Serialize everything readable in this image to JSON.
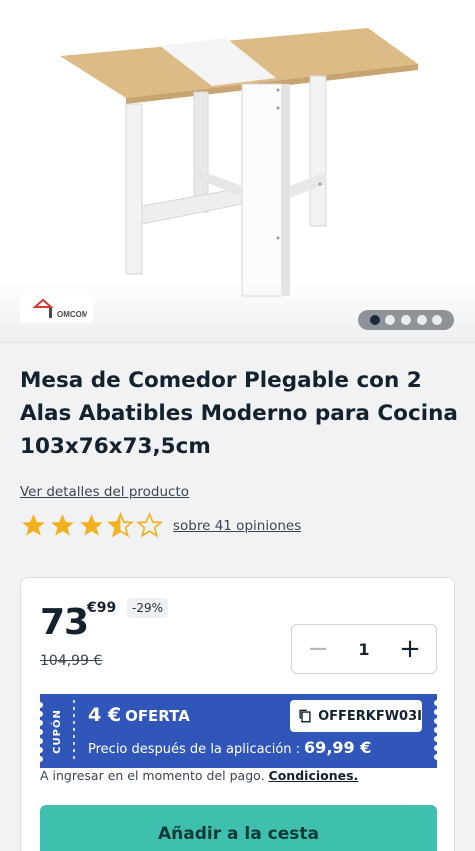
{
  "gallery": {
    "brand_logo_text": "HOMCOM",
    "slide_count": 5,
    "active_slide": 1
  },
  "product": {
    "title": "Mesa de Comedor Plegable con 2 Alas Abatibles Moderno para Cocina 103x76x73,5cm",
    "details_link": "Ver detalles del producto",
    "rating": 3.5,
    "rating_max": 5,
    "reviews_link": "sobre 41 opiniones"
  },
  "pricing": {
    "price_integer": "73",
    "price_cents": "€99",
    "discount": "-29%",
    "old_price": "104,99 €"
  },
  "quantity": {
    "value": "1",
    "minus": "−",
    "plus": "+"
  },
  "coupon": {
    "side_label": "CUPÓN",
    "amount": "4 €",
    "type": "OFERTA",
    "code": "OFFERKFW03I",
    "after_label": "Precio después de la aplicación :",
    "after_price": "69,99 €"
  },
  "conditions": {
    "text": "A ingresar en el momento del pago.",
    "link": "Condiciones."
  },
  "cart": {
    "add_label": "Añadir a la cesta"
  },
  "colors": {
    "coupon_blue": "#2f56b8",
    "add_button": "#3fbfae",
    "star": "#f2b21f"
  }
}
